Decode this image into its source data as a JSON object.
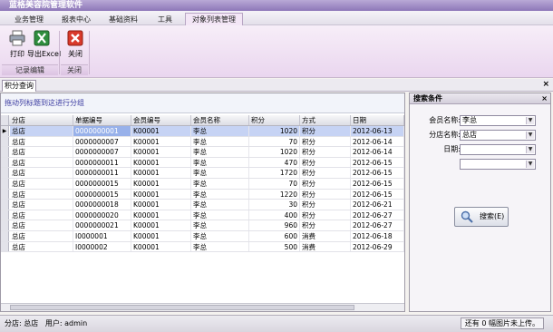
{
  "app": {
    "title": "蓝格美容院管理软件"
  },
  "menu": {
    "tabs": [
      "业务管理",
      "报表中心",
      "基础资料",
      "工具",
      "对象列表管理"
    ]
  },
  "ribbon": {
    "print_label": "打印",
    "export_label": "导出Excel",
    "close_label": "关闭",
    "group_records": "记录编辑",
    "group_close": "关闭"
  },
  "doc": {
    "tab_label": "积分查询",
    "close_glyph": "×"
  },
  "grid": {
    "group_hint": "拖动列标题到这进行分组",
    "headers": [
      "分店",
      "单据编号",
      "会员编号",
      "会员名称",
      "积分",
      "方式",
      "日期"
    ],
    "rows": [
      [
        "总店",
        "0000000001",
        "K00001",
        "李总",
        "1020",
        "积分",
        "2012-06-13"
      ],
      [
        "总店",
        "0000000007",
        "K00001",
        "李总",
        "70",
        "积分",
        "2012-06-14"
      ],
      [
        "总店",
        "0000000007",
        "K00001",
        "李总",
        "1020",
        "积分",
        "2012-06-14"
      ],
      [
        "总店",
        "0000000011",
        "K00001",
        "李总",
        "470",
        "积分",
        "2012-06-15"
      ],
      [
        "总店",
        "0000000011",
        "K00001",
        "李总",
        "1720",
        "积分",
        "2012-06-15"
      ],
      [
        "总店",
        "0000000015",
        "K00001",
        "李总",
        "70",
        "积分",
        "2012-06-15"
      ],
      [
        "总店",
        "0000000015",
        "K00001",
        "李总",
        "1220",
        "积分",
        "2012-06-15"
      ],
      [
        "总店",
        "0000000018",
        "K00001",
        "李总",
        "30",
        "积分",
        "2012-06-21"
      ],
      [
        "总店",
        "0000000020",
        "K00001",
        "李总",
        "400",
        "积分",
        "2012-06-27"
      ],
      [
        "总店",
        "0000000021",
        "K00001",
        "李总",
        "960",
        "积分",
        "2012-06-27"
      ],
      [
        "总店",
        "I0000001",
        "K00001",
        "李总",
        "600",
        "消费",
        "2012-06-18"
      ],
      [
        "总店",
        "I0000002",
        "K00001",
        "李总",
        "500",
        "消费",
        "2012-06-29"
      ]
    ]
  },
  "search": {
    "title": "搜索条件",
    "close_glyph": "×",
    "member_label": "会员名称:",
    "member_value": "李总",
    "branch_label": "分店名称:",
    "branch_value": "总店",
    "date_label": "日期:",
    "date_from": "",
    "date_to": "",
    "button_label": "搜索(E)"
  },
  "status": {
    "branch_text": "分店: 总店",
    "user_text": "用户: admin",
    "upload_text": "还有 0 幅图片未上传。"
  },
  "colors": {
    "selected_row": "#c6d3f4",
    "ribbon": "#ead6ef",
    "hint_text": "#3a3aa0"
  }
}
